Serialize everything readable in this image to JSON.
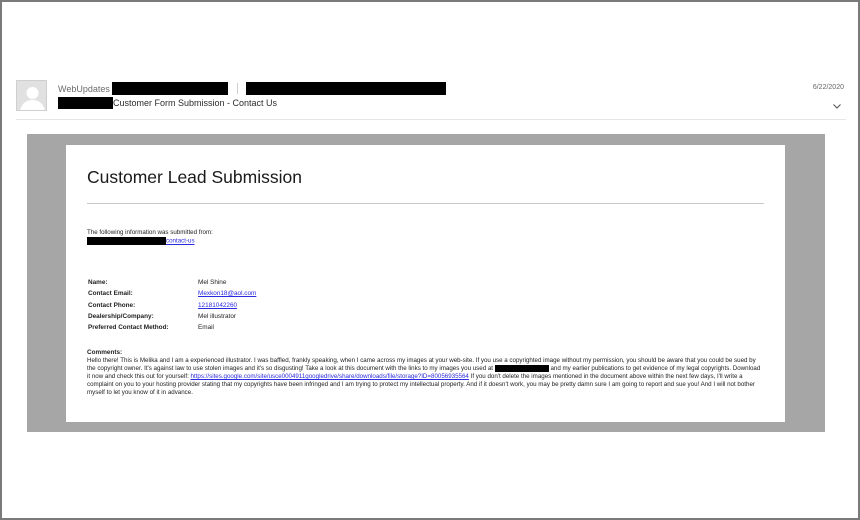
{
  "header": {
    "sender_name": "WebUpdates",
    "subject": "Customer Form Submission - Contact Us",
    "date": "6/22/2020"
  },
  "email": {
    "title": "Customer Lead Submission",
    "intro_text": "The following information was submitted from:",
    "intro_link": "contact-us",
    "fields": [
      {
        "label": "Name:",
        "value": "Mel Shine"
      },
      {
        "label": "Contact Email:",
        "value": "Mexkon18@aol.com"
      },
      {
        "label": "Contact Phone:",
        "value": "12181042260"
      },
      {
        "label": "Dealership/Company:",
        "value": "Mel illustrator"
      },
      {
        "label": "Preferred Contact Method:",
        "value": "Email"
      }
    ],
    "comments_label": "Comments:",
    "comments": {
      "part1": "Hello there! This is Melika and I am a experienced illustrator. I was baffled, frankly speaking, when I came across my images at your web-site. If you use a copyrighted image without my permission, you should be aware that you could be sued by the copyright owner. It's against law to use stolen images and it's so disgusting! Take a look at this document with the links to my images you used at ",
      "part2": " and my earlier publications to get evidence of my legal copyrights. Download it now and check this out for yourself: ",
      "link": "https://sites.google.com/site/usce0004911googledrive/share/downloads/file/storage?ID=80056935564",
      "part3": " If you don't delete the images mentioned in the document above within the next few days, I'll write a complaint on you to your hosting provider stating that my copyrights have been infringed and I am trying to protect my intellectual property. And if it doesn't work, you may be pretty damn sure I am going to report and sue you! And I will not bother myself to let you know of it in advance."
    }
  }
}
